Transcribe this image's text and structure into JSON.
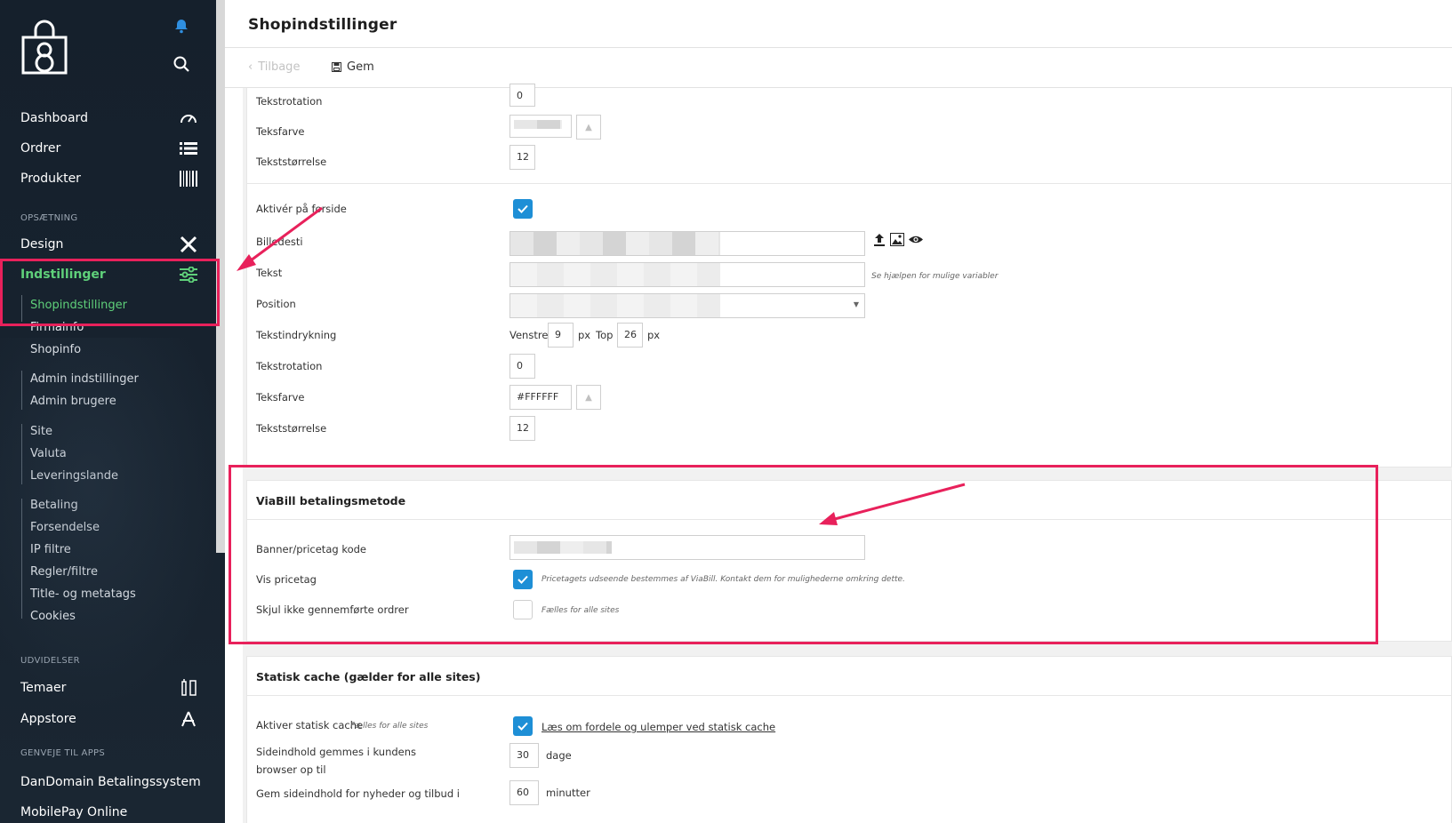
{
  "sidebar": {
    "logo": "shop-bag-logo",
    "nav": {
      "dashboard": "Dashboard",
      "ordrer": "Ordrer",
      "produkter": "Produkter",
      "design": "Design",
      "indstillinger": "Indstillinger",
      "temaer": "Temaer",
      "appstore": "Appstore",
      "dandomain": "DanDomain Betalingssystem",
      "mobilepay": "MobilePay Online"
    },
    "sections": {
      "opsaetning": "OPSÆTNING",
      "udvidelser": "UDVIDELSER",
      "genveje": "GENVEJE TIL APPS"
    },
    "sub": {
      "shopindstillinger": "Shopindstillinger",
      "firmainfo": "Firmainfo",
      "shopinfo": "Shopinfo",
      "admin_indstillinger": "Admin indstillinger",
      "admin_brugere": "Admin brugere",
      "site": "Site",
      "valuta": "Valuta",
      "leveringslande": "Leveringslande",
      "betaling": "Betaling",
      "forsendelse": "Forsendelse",
      "ip_filtre": "IP filtre",
      "regler_filtre": "Regler/filtre",
      "title_metatags": "Title- og metatags",
      "cookies": "Cookies"
    }
  },
  "header": {
    "title": "Shopindstillinger"
  },
  "actions": {
    "back": "Tilbage",
    "save": "Gem"
  },
  "upper": {
    "tekstrotation_label": "Tekstrotation",
    "tekstrotation_value": "0",
    "teksfarve_label": "Teksfarve",
    "teksfarve_value": "#FFFFFF",
    "tekststorrelse_label": "Tekststørrelse",
    "tekststorrelse_value": "12",
    "aktiver_label": "Aktivér på forside",
    "billedesti_label": "Billedesti",
    "tekst_label": "Tekst",
    "tekst_hint": "Se hjælpen for mulige variabler",
    "position_label": "Position",
    "indrykning_label": "Tekstindrykning",
    "venstre_label": "Venstre",
    "venstre_value": "9",
    "px_unit": "px",
    "top_label": "Top",
    "top_value": "26",
    "tekstrotation2_value": "0",
    "teksfarve2_value": "#FFFFFF",
    "tekststorrelse2_value": "12"
  },
  "viabill": {
    "title": "ViaBill betalingsmetode",
    "banner_label": "Banner/pricetag kode",
    "vis_label": "Vis pricetag",
    "vis_hint": "Pricetagets udseende bestemmes af ViaBill. Kontakt dem for mulighederne omkring dette.",
    "skjul_label": "Skjul ikke gennemførte ordrer",
    "skjul_hint": "Fælles for alle sites"
  },
  "cache": {
    "title": "Statisk cache (gælder for alle sites)",
    "aktiver_label": "Aktiver statisk cache",
    "aktiver_hint": "Fælles for alle sites",
    "link": "Læs om fordele og ulemper ved statisk cache",
    "sideindhold_label_1": "Sideindhold gemmes i kundens",
    "sideindhold_label_2": "browser op til",
    "sideindhold_value": "30",
    "dage_unit": "dage",
    "nyheder_label": "Gem sideindhold for nyheder og tilbud i",
    "nyheder_value": "60",
    "minutter_unit": "minutter"
  },
  "colors": {
    "accent_green": "#5fd07a",
    "highlight": "#e8215b",
    "checkbox": "#1e8fd6",
    "sidebar_bg": "#15202c"
  }
}
